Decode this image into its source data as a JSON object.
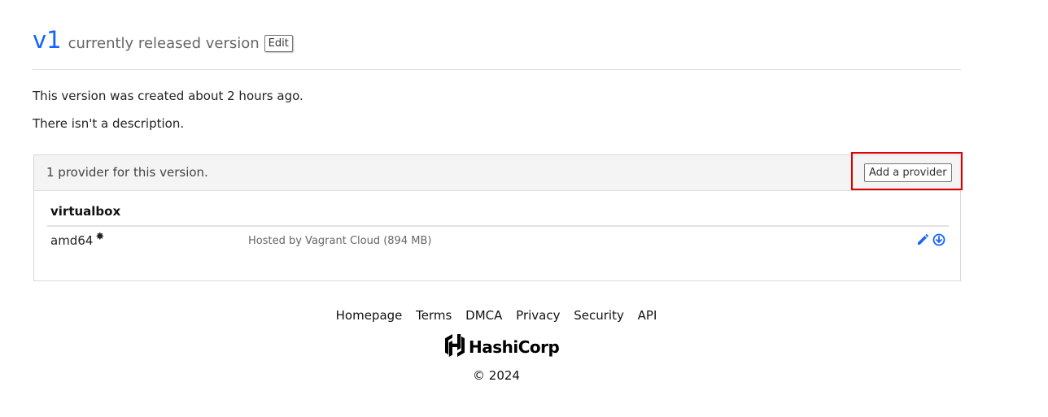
{
  "header": {
    "version": "v1",
    "subtitle": "currently released version",
    "edit_label": "Edit"
  },
  "info": {
    "created": "This version was created about 2 hours ago.",
    "description": "There isn't a description."
  },
  "providers_panel": {
    "summary": "1 provider for this version.",
    "add_label": "Add a provider",
    "providers": [
      {
        "name": "virtualbox",
        "architecture": "amd64",
        "default_marker": "✸",
        "hosting": "Hosted by Vagrant Cloud (894 MB)",
        "icons": [
          "pencil-icon",
          "download-circle-icon"
        ]
      }
    ]
  },
  "footer": {
    "links": [
      "Homepage",
      "Terms",
      "DMCA",
      "Privacy",
      "Security",
      "API"
    ],
    "logo_text": "HashiCorp",
    "copyright": "© 2024"
  },
  "colors": {
    "accent": "#1563ff",
    "highlight": "#e00000"
  }
}
